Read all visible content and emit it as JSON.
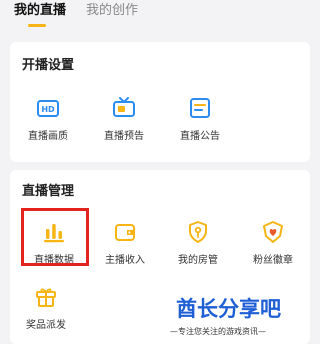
{
  "tabs": [
    {
      "label": "我的直播"
    },
    {
      "label": "我的创作"
    }
  ],
  "accent_color": "#f7b515",
  "setup": {
    "title": "开播设置",
    "items": [
      {
        "label": "直播画质",
        "icon": "hd-icon"
      },
      {
        "label": "直播预告",
        "icon": "tv-icon"
      },
      {
        "label": "直播公告",
        "icon": "announcement-icon"
      }
    ]
  },
  "manage": {
    "title": "直播管理",
    "items": [
      {
        "label": "直播数据",
        "icon": "bar-chart-icon"
      },
      {
        "label": "主播收入",
        "icon": "wallet-icon"
      },
      {
        "label": "我的房管",
        "icon": "shield-key-icon"
      },
      {
        "label": "粉丝徽章",
        "icon": "heart-badge-icon"
      },
      {
        "label": "奖品派发",
        "icon": "gift-icon"
      }
    ]
  },
  "watermark": {
    "title": "酋长分享吧",
    "subtitle": "—专注您关注的游戏资讯—"
  }
}
